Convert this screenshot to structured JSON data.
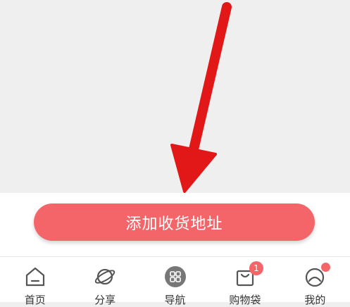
{
  "main": {
    "add_address_label": "添加收货地址"
  },
  "bottom_nav": {
    "items": [
      {
        "label": "首页",
        "icon": "home-icon"
      },
      {
        "label": "分享",
        "icon": "planet-icon"
      },
      {
        "label": "导航",
        "icon": "grid-icon"
      },
      {
        "label": "购物袋",
        "icon": "shopping-bag-icon",
        "badge": "1"
      },
      {
        "label": "我的",
        "icon": "profile-icon",
        "has_dot": true
      }
    ]
  },
  "colors": {
    "accent": "#f4656a",
    "arrow": "#e21818",
    "background": "#efefef"
  }
}
